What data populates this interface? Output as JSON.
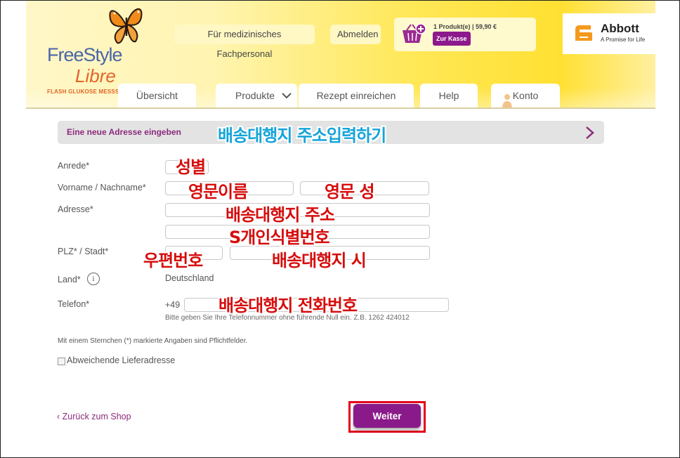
{
  "header": {
    "logo": {
      "line1": "FreeStyle",
      "line2": "Libre",
      "tagline": "FLASH GLUKOSE MESSSYSTEM"
    },
    "top_links": [
      {
        "label": "Für medizinisches Fachpersonal"
      },
      {
        "label": "Abmelden"
      }
    ],
    "cart": {
      "summary": "1 Produkt(e) | 59,90 €",
      "checkout_label": "Zur Kasse"
    },
    "brand": {
      "name": "Abbott",
      "tagline": "A Promise for Life"
    },
    "nav": [
      {
        "label": "Übersicht"
      },
      {
        "label": "Produkte"
      },
      {
        "label": "Rezept einreichen"
      },
      {
        "label": "Help"
      },
      {
        "label": "Konto"
      }
    ]
  },
  "section": {
    "title": "Eine neue Adresse eingeben",
    "annotation": "배송대행지 주소입력하기"
  },
  "form": {
    "salutation_label": "Anrede*",
    "name_label": "Vorname / Nachname*",
    "address_label": "Adresse*",
    "zip_city_label": "PLZ*  / Stadt*",
    "country_label": "Land*",
    "country_value": "Deutschland",
    "info_glyph": "i",
    "phone_label": "Telefon*",
    "phone_prefix": "+49",
    "phone_hint": "Bitte geben Sie Ihre Telefonnummer ohne führende Null ein. Z.B. 1262 424012",
    "required_note": "Mit einem Sternchen (*) markierte Angaben sind Pflichtfelder.",
    "alt_delivery_label": "Abweichende Lieferadresse",
    "alt_delivery_checked": false,
    "fields": {
      "salutation": "",
      "first_name": "",
      "last_name": "",
      "address1": "",
      "address2": "",
      "zip": "",
      "city": "",
      "phone": ""
    }
  },
  "annotations": {
    "salutation": "성별",
    "first_name": "영문이름",
    "last_name": "영문 성",
    "address1": "배송대행지 주소",
    "address2": "S개인식별번호",
    "zip": "우편번호",
    "city": "배송대행지 시",
    "phone": "배송대행지 전화번호"
  },
  "footer": {
    "back_label": "‹ Zurück zum Shop",
    "continue_label": "Weiter"
  },
  "colors": {
    "brand_purple": "#8a1a8a",
    "highlight_red": "#e4001a",
    "annotation_red": "#d60d0d",
    "annotation_cyan": "#14a4d8"
  }
}
